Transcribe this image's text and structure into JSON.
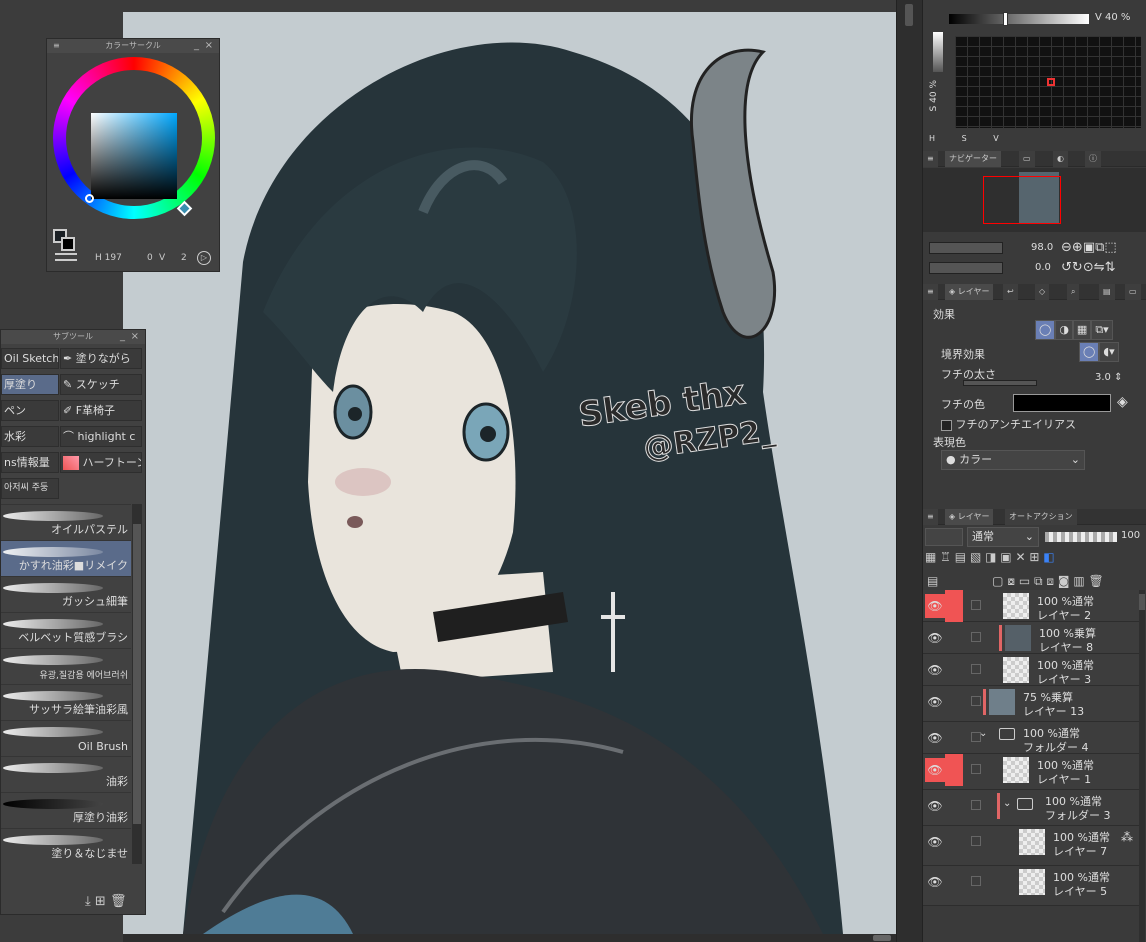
{
  "color_circle": {
    "title": "カラーサークル",
    "h_value": "197",
    "s_value": "0",
    "v_value": "2"
  },
  "subtool": {
    "title": "サブツール",
    "tabs": [
      {
        "label": "Oil Sketch"
      },
      {
        "label": "塗りながら"
      },
      {
        "label": "厚塗り"
      },
      {
        "label": "スケッチ"
      },
      {
        "label": "ペン"
      },
      {
        "label": "F革椅子"
      },
      {
        "label": "水彩"
      },
      {
        "label": "highlight c"
      },
      {
        "label": "ns情報量"
      },
      {
        "label": "ハーフトーン"
      },
      {
        "label": "아저씨 주둥"
      }
    ],
    "brushes": [
      {
        "label": "オイルパステル"
      },
      {
        "label": "かすれ油彩■リメイク"
      },
      {
        "label": "ガッシュ細筆"
      },
      {
        "label": "ベルベット質感ブラシ"
      },
      {
        "label": "유광,질감용 에어브러쉬"
      },
      {
        "label": "サッサラ絵筆油彩風"
      },
      {
        "label": "Oil Brush"
      },
      {
        "label": "油彩"
      },
      {
        "label": "厚塗り油彩"
      },
      {
        "label": "塗り＆なじませ"
      }
    ]
  },
  "hsv_panel": {
    "v_label": "V",
    "v_value": "40 %",
    "s_label": "S",
    "s_value": "40 %",
    "foot_h": "H",
    "foot_s": "S",
    "foot_v": "V"
  },
  "navigator": {
    "tab_label": "ナビゲーター",
    "zoom_value": "98.0",
    "rotate_value": "0.0"
  },
  "layer_property": {
    "tab_label": "レイヤー",
    "effect_label": "効果",
    "border_effect_label": "境界効果",
    "edge_size_label": "フチの太さ",
    "edge_size_value": "3.0",
    "edge_color_label": "フチの色",
    "antialias_label": "フチのアンチエイリアス",
    "expression_color_label": "表現色",
    "expression_color_value": "カラー"
  },
  "layers_panel": {
    "tab_layer": "レイヤー",
    "tab_auto_action": "オートアクション",
    "blend_mode": "通常",
    "opacity": "100",
    "layers": [
      {
        "opacity_mode": "100 %通常",
        "name": "レイヤー 2"
      },
      {
        "opacity_mode": "100 %乗算",
        "name": "レイヤー 8"
      },
      {
        "opacity_mode": "100 %通常",
        "name": "レイヤー 3"
      },
      {
        "opacity_mode": "75 %乗算",
        "name": "レイヤー 13"
      },
      {
        "opacity_mode": "100 %通常",
        "name": "フォルダー 4"
      },
      {
        "opacity_mode": "100 %通常",
        "name": "レイヤー 1"
      },
      {
        "opacity_mode": "100 %通常",
        "name": "フォルダー 3"
      },
      {
        "opacity_mode": "100 %通常",
        "name": "レイヤー 7"
      },
      {
        "opacity_mode": "100 %通常",
        "name": "レイヤー 5"
      }
    ]
  },
  "artwork": {
    "signature_line1": "Skeb thx",
    "signature_line2": "@RZP2_"
  }
}
